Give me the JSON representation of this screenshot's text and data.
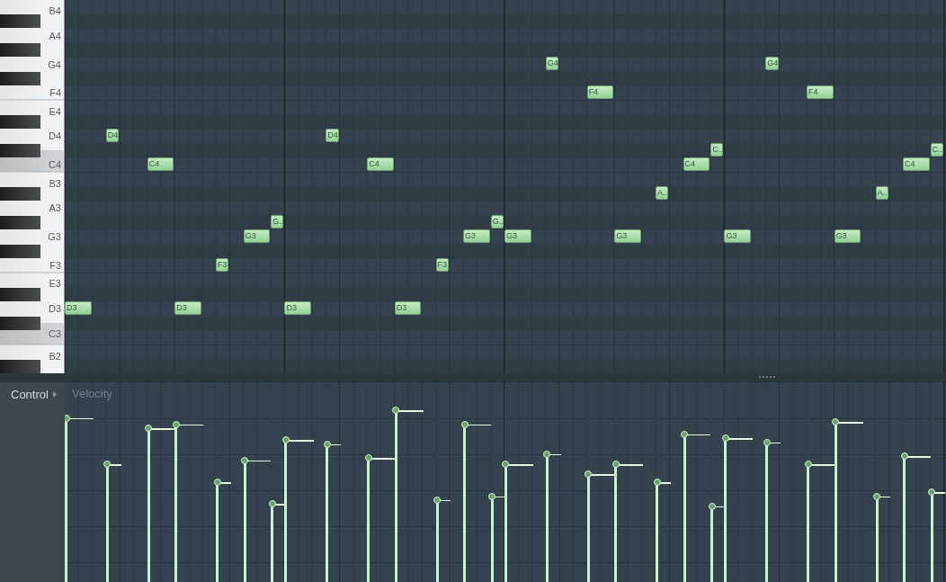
{
  "piano_roll": {
    "keys": [
      "B4",
      "A4",
      "G4",
      "F4",
      "E4",
      "D4",
      "C4",
      "B3",
      "A3",
      "G3",
      "F3",
      "E3",
      "D3",
      "C3",
      "B2"
    ],
    "notes": [
      {
        "label": "D3",
        "level": 0.82
      },
      {
        "label": "D4",
        "level": 0.59
      },
      {
        "label": "C4",
        "level": 0.77
      },
      {
        "label": "D3",
        "level": 0.79
      },
      {
        "label": "F3",
        "level": 0.5
      },
      {
        "label": "G3",
        "level": 0.61
      },
      {
        "label": "G..",
        "level": 0.39
      },
      {
        "label": "D3",
        "level": 0.71
      },
      {
        "label": "D4",
        "level": 0.69
      },
      {
        "label": "C4",
        "level": 0.62
      },
      {
        "label": "D3",
        "level": 0.86
      },
      {
        "label": "F3",
        "level": 0.41
      },
      {
        "label": "G3",
        "level": 0.79
      },
      {
        "label": "G..",
        "level": 0.43
      },
      {
        "label": "G3",
        "level": 0.59
      },
      {
        "label": "G4",
        "level": 0.64
      },
      {
        "label": "F4",
        "level": 0.54
      },
      {
        "label": "G3",
        "level": 0.59
      },
      {
        "label": "A..",
        "level": 0.5
      },
      {
        "label": "C4",
        "level": 0.74
      },
      {
        "label": "C..",
        "level": 0.38
      },
      {
        "label": "G3",
        "level": 0.72
      },
      {
        "label": "G4",
        "level": 0.7
      },
      {
        "label": "F4",
        "level": 0.59
      },
      {
        "label": "G3",
        "level": 0.8
      },
      {
        "label": "A..",
        "level": 0.43
      },
      {
        "label": "C4",
        "level": 0.63
      },
      {
        "label": "C..",
        "level": 0.45
      }
    ]
  },
  "control_panel": {
    "label": "Control",
    "parameter": "Velocity"
  }
}
